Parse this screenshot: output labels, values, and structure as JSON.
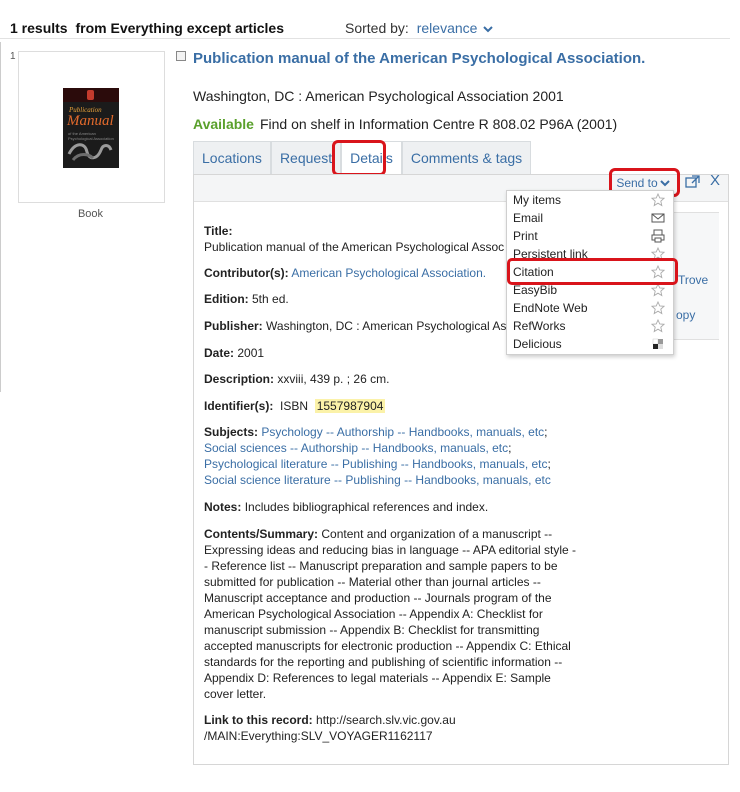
{
  "header": {
    "results_count": "1 results",
    "scope": "from Everything except articles",
    "sorted_by_label": "Sorted by:",
    "sorted_by_value": "relevance"
  },
  "result": {
    "number": "1",
    "format": "Book",
    "cover": {
      "line1": "Publication",
      "line2": "Manual",
      "line3": "of the American Psychological Association"
    },
    "title": "Publication manual of the American Psychological Association.",
    "publication": "Washington, DC : American Psychological Association 2001",
    "availability_status": "Available",
    "availability_text": "Find on shelf in Information Centre  R 808.02 P96A (2001)"
  },
  "tabs": [
    {
      "label": "Locations"
    },
    {
      "label": "Request"
    },
    {
      "label": "Details"
    },
    {
      "label": "Comments & tags"
    }
  ],
  "toolbar": {
    "send_to_label": "Send to",
    "close_label": "X"
  },
  "side_panel": {
    "trove_label": "Trove",
    "copy_label": "opy",
    "small_label": "l"
  },
  "send_menu": {
    "items": [
      {
        "label": "My items",
        "icon": "star-icon"
      },
      {
        "label": "Email",
        "icon": "envelope-icon"
      },
      {
        "label": "Print",
        "icon": "printer-icon"
      },
      {
        "label": "Persistent link",
        "icon": "star-icon"
      },
      {
        "label": "Citation",
        "icon": "star-icon"
      },
      {
        "label": "EasyBib",
        "icon": "star-icon"
      },
      {
        "label": "EndNote Web",
        "icon": "star-icon"
      },
      {
        "label": "RefWorks",
        "icon": "star-icon"
      },
      {
        "label": "Delicious",
        "icon": "delicious-icon"
      }
    ]
  },
  "details": {
    "title_label": "Title:",
    "title_value": "Publication manual of the American Psychological Assoc",
    "contributor_label": "Contributor(s):",
    "contributor_value": "American Psychological Association.",
    "edition_label": "Edition:",
    "edition_value": "5th ed.",
    "publisher_label": "Publisher:",
    "publisher_value": "Washington, DC : American Psychological As",
    "date_label": "Date:",
    "date_value": "2001",
    "description_label": "Description:",
    "description_value": "xxviii, 439 p. ; 26 cm.",
    "identifier_label": "Identifier(s):",
    "identifier_prefix": "ISBN",
    "identifier_value": "1557987904",
    "subjects_label": "Subjects:",
    "subjects": [
      "Psychology -- Authorship -- Handbooks, manuals, etc",
      "Social sciences -- Authorship -- Handbooks, manuals, etc",
      "Psychological literature -- Publishing -- Handbooks, manuals, etc",
      "Social science literature -- Publishing -- Handbooks, manuals, etc"
    ],
    "subjects_separator": ";",
    "notes_label": "Notes:",
    "notes_value": "Includes bibliographical references and index.",
    "contents_label": "Contents/Summary:",
    "contents_value": "Content and organization of a manuscript -- Expressing ideas and reducing bias in language -- APA editorial style -- Reference list -- Manuscript preparation and sample papers to be submitted for publication -- Material other than journal articles -- Manuscript acceptance and production -- Journals program of the American Psychological Association -- Appendix A: Checklist for manuscript submission -- Appendix B: Checklist for transmitting accepted manuscripts for electronic production -- Appendix C: Ethical standards for the reporting and publishing of scientific information -- Appendix D: References to legal materials -- Appendix E: Sample cover letter.",
    "link_label": "Link to this record:",
    "link_value_1": "http://search.slv.vic.gov.au",
    "link_value_2": "/MAIN:Everything:SLV_VOYAGER1162117"
  },
  "colors": {
    "link": "#3a6ea5",
    "available": "#5aa02c",
    "highlight_box": "#d9141b",
    "isbn_highlight": "#fbf2a9"
  }
}
